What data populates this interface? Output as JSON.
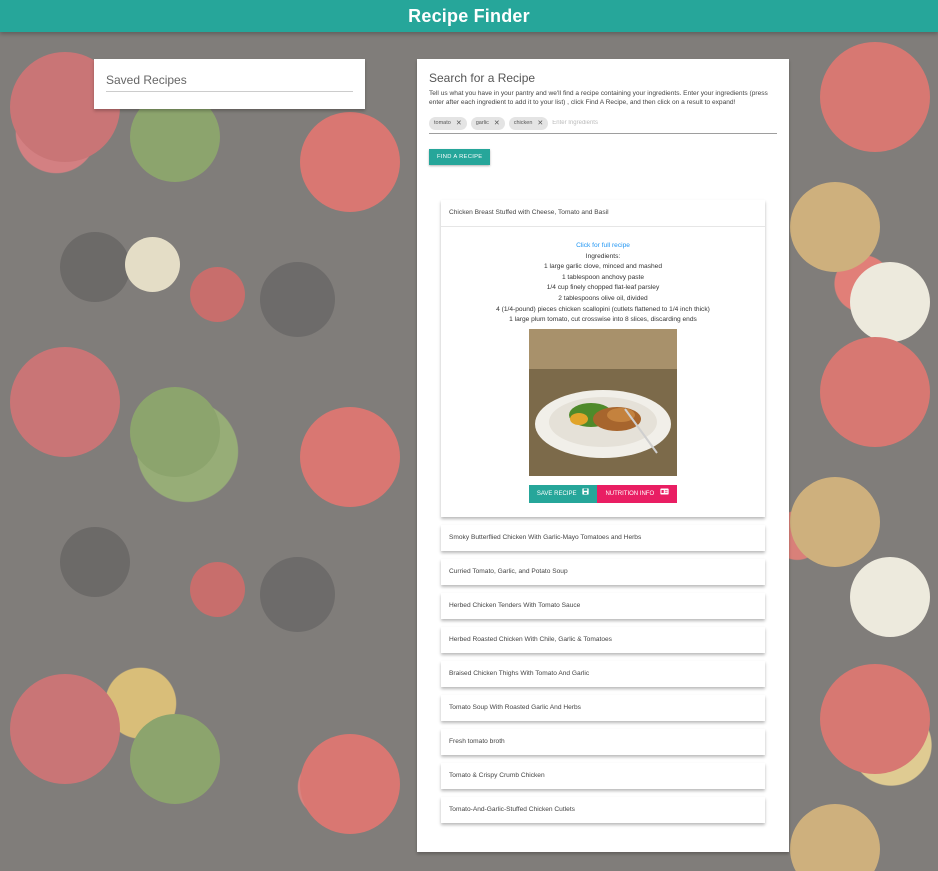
{
  "app": {
    "title": "Recipe Finder"
  },
  "saved": {
    "title": "Saved Recipes"
  },
  "search": {
    "heading": "Search for a Recipe",
    "description": "Tell us what you have in your pantry and we'll find a recipe containing your ingredients. Enter your ingredients (press enter after each ingredient to add it to your list) , click Find A Recipe, and then click on a result to expand!",
    "chips": [
      {
        "label": "tomato",
        "remove_icon": "close-icon"
      },
      {
        "label": "garlic",
        "remove_icon": "close-icon"
      },
      {
        "label": "chicken",
        "remove_icon": "close-icon"
      }
    ],
    "input_placeholder": "Enter Ingredients",
    "find_button": "Find a Recipe"
  },
  "results": [
    {
      "title": "Chicken Breast Stuffed with Cheese, Tomato and Basil",
      "expanded": true,
      "link_text": "Click for full recipe",
      "ingredients_label": "Ingredients:",
      "ingredients": [
        "1 large garlic clove, minced and mashed",
        "1 tablespoon anchovy paste",
        "1/4 cup finely chopped flat-leaf parsley",
        "2 tablespoons olive oil, divided",
        "4 (1/4-pound) pieces chicken scallopini (cutlets flattened to 1/4 inch thick)",
        "1 large plum tomato, cut crosswise into 8 slices, discarding ends"
      ],
      "save_label": "Save Recipe",
      "save_icon": "floppy-disk-icon",
      "nutrition_label": "Nutrition Info",
      "nutrition_icon": "id-card-icon"
    },
    {
      "title": "Smoky Butterflied Chicken With Garlic-Mayo Tomatoes and Herbs"
    },
    {
      "title": "Curried Tomato, Garlic, and Potato Soup"
    },
    {
      "title": "Herbed Chicken Tenders With Tomato Sauce"
    },
    {
      "title": "Herbed Roasted Chicken With Chile, Garlic & Tomatoes"
    },
    {
      "title": "Braised Chicken Thighs With Tomato And Garlic"
    },
    {
      "title": "Tomato Soup With Roasted Garlic And Herbs"
    },
    {
      "title": "Fresh tomato broth"
    },
    {
      "title": "Tomato & Crispy Crumb Chicken"
    },
    {
      "title": "Tomato-And-Garlic-Stuffed Chicken Cutlets"
    }
  ],
  "colors": {
    "primary": "#26a69a",
    "accent": "#e91e63",
    "link": "#2196f3"
  }
}
